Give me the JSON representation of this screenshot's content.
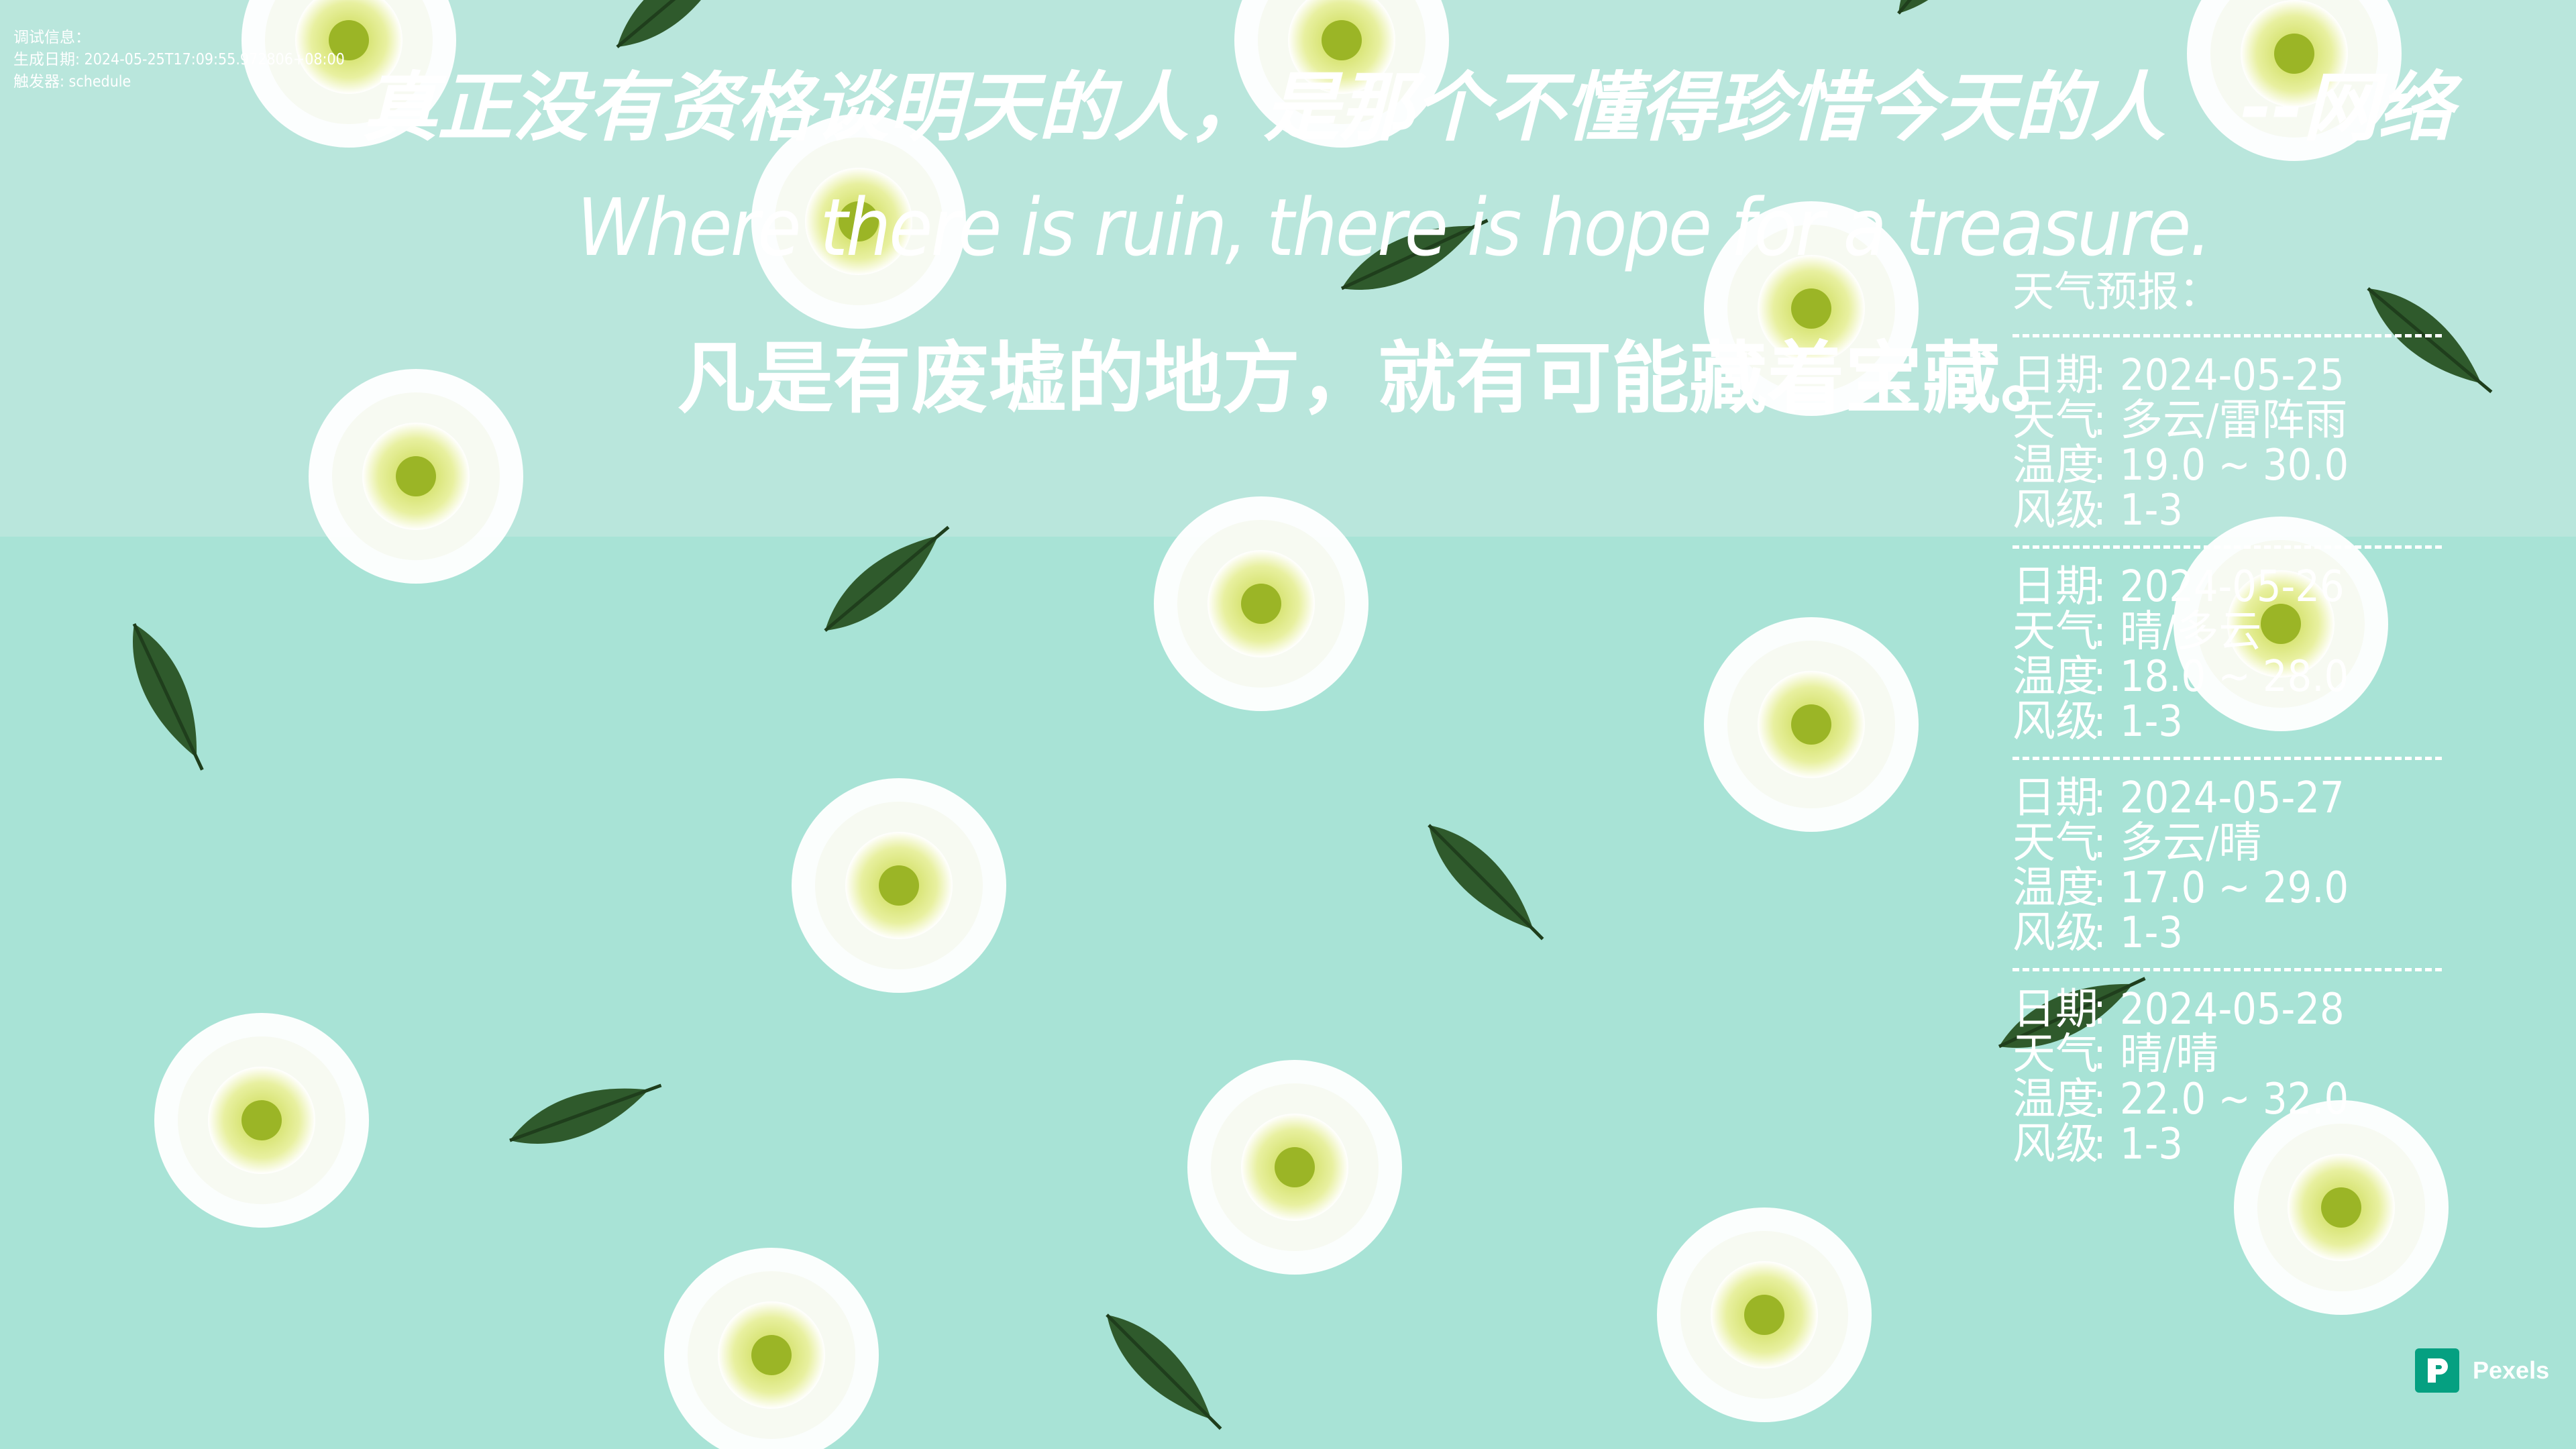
{
  "debug": {
    "line1": "调试信息：",
    "line2": "生成日期: 2024-05-25T17:09:55.972806+08:00",
    "line3": "触发器: schedule"
  },
  "quote": {
    "zh": "真正没有资格谈明天的人，是那个不懂得珍惜今天的人　--网络",
    "en": "Where there is ruin, there is hope for a treasure.",
    "zh_translation": "凡是有废墟的地方，就有可能藏着宝藏。"
  },
  "weather": {
    "title": "天气预报：",
    "labels": {
      "date": "日期",
      "weather": "天气",
      "temp": "温度",
      "wind": "风级"
    },
    "colon": ":",
    "days": [
      {
        "date": "2024-05-25",
        "weather": "多云/雷阵雨",
        "temp": "19.0 ~ 30.0",
        "wind": "1-3"
      },
      {
        "date": "2024-05-26",
        "weather": "晴/多云",
        "temp": "18.0 ~ 28.0",
        "wind": "1-3"
      },
      {
        "date": "2024-05-27",
        "weather": "多云/晴",
        "temp": "17.0 ~ 29.0",
        "wind": "1-3"
      },
      {
        "date": "2024-05-28",
        "weather": "晴/晴",
        "temp": "22.0 ~ 32.0",
        "wind": "1-3"
      }
    ]
  },
  "pexels": {
    "label": "Pexels",
    "icon": "pexels-logo-icon",
    "color": "#05a081"
  },
  "colors": {
    "background": "#a8e3d6",
    "text": "#ffffff"
  }
}
